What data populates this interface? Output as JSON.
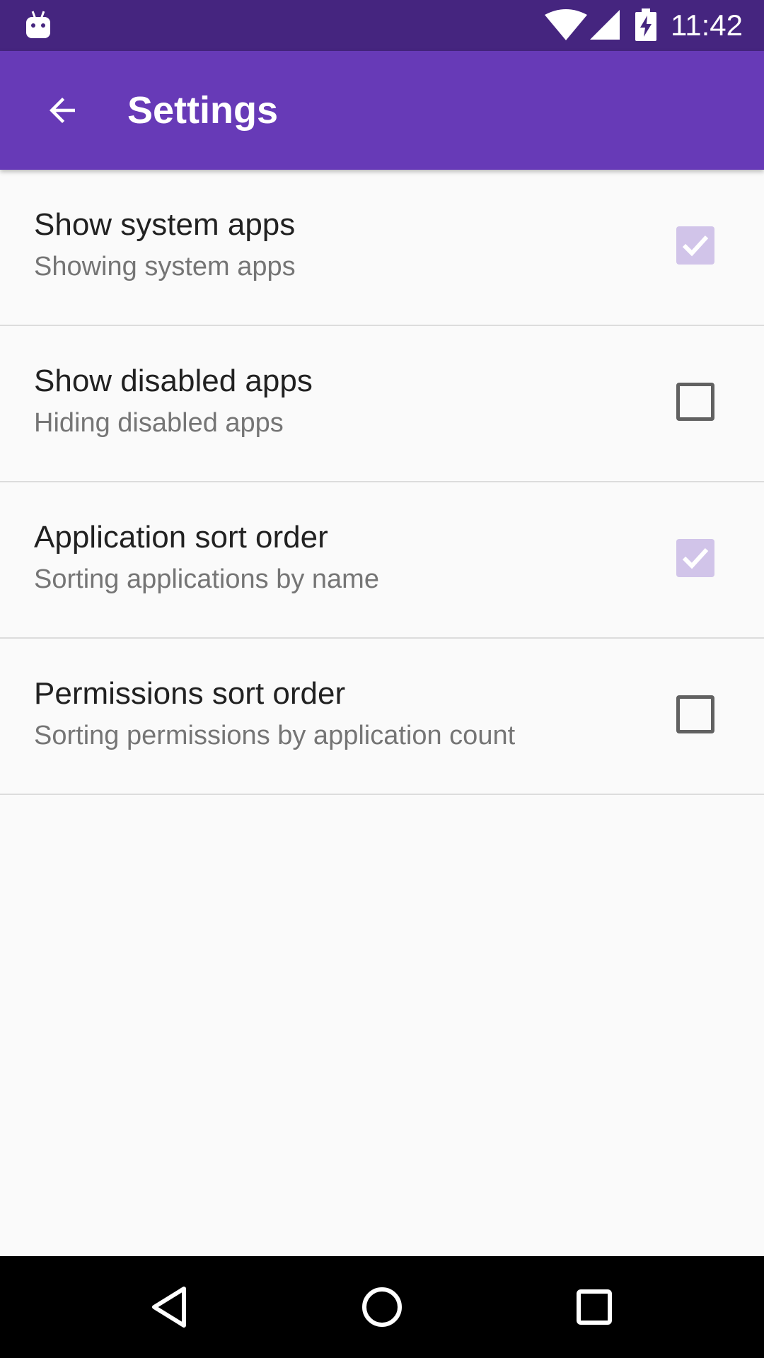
{
  "status_bar": {
    "time": "11:42",
    "icons": [
      "android-debug-icon",
      "wifi-icon",
      "cell-signal-icon",
      "battery-charging-icon"
    ]
  },
  "app_bar": {
    "title": "Settings",
    "back_icon": "arrow-back-icon",
    "background": "#673ab7"
  },
  "settings": [
    {
      "title": "Show system apps",
      "summary": "Showing system apps",
      "checked": true
    },
    {
      "title": "Show disabled apps",
      "summary": "Hiding disabled apps",
      "checked": false
    },
    {
      "title": "Application sort order",
      "summary": "Sorting applications by name",
      "checked": true
    },
    {
      "title": "Permissions sort order",
      "summary": "Sorting permissions by application count",
      "checked": false
    }
  ],
  "nav_bar": {
    "buttons": [
      "back-triangle-icon",
      "home-circle-icon",
      "recents-square-icon"
    ]
  },
  "colors": {
    "status_bar": "#45257f",
    "primary": "#673ab7",
    "checkbox_checked": "#d1c4e9",
    "checkbox_unchecked_border": "#616161",
    "background": "#fafafa"
  }
}
